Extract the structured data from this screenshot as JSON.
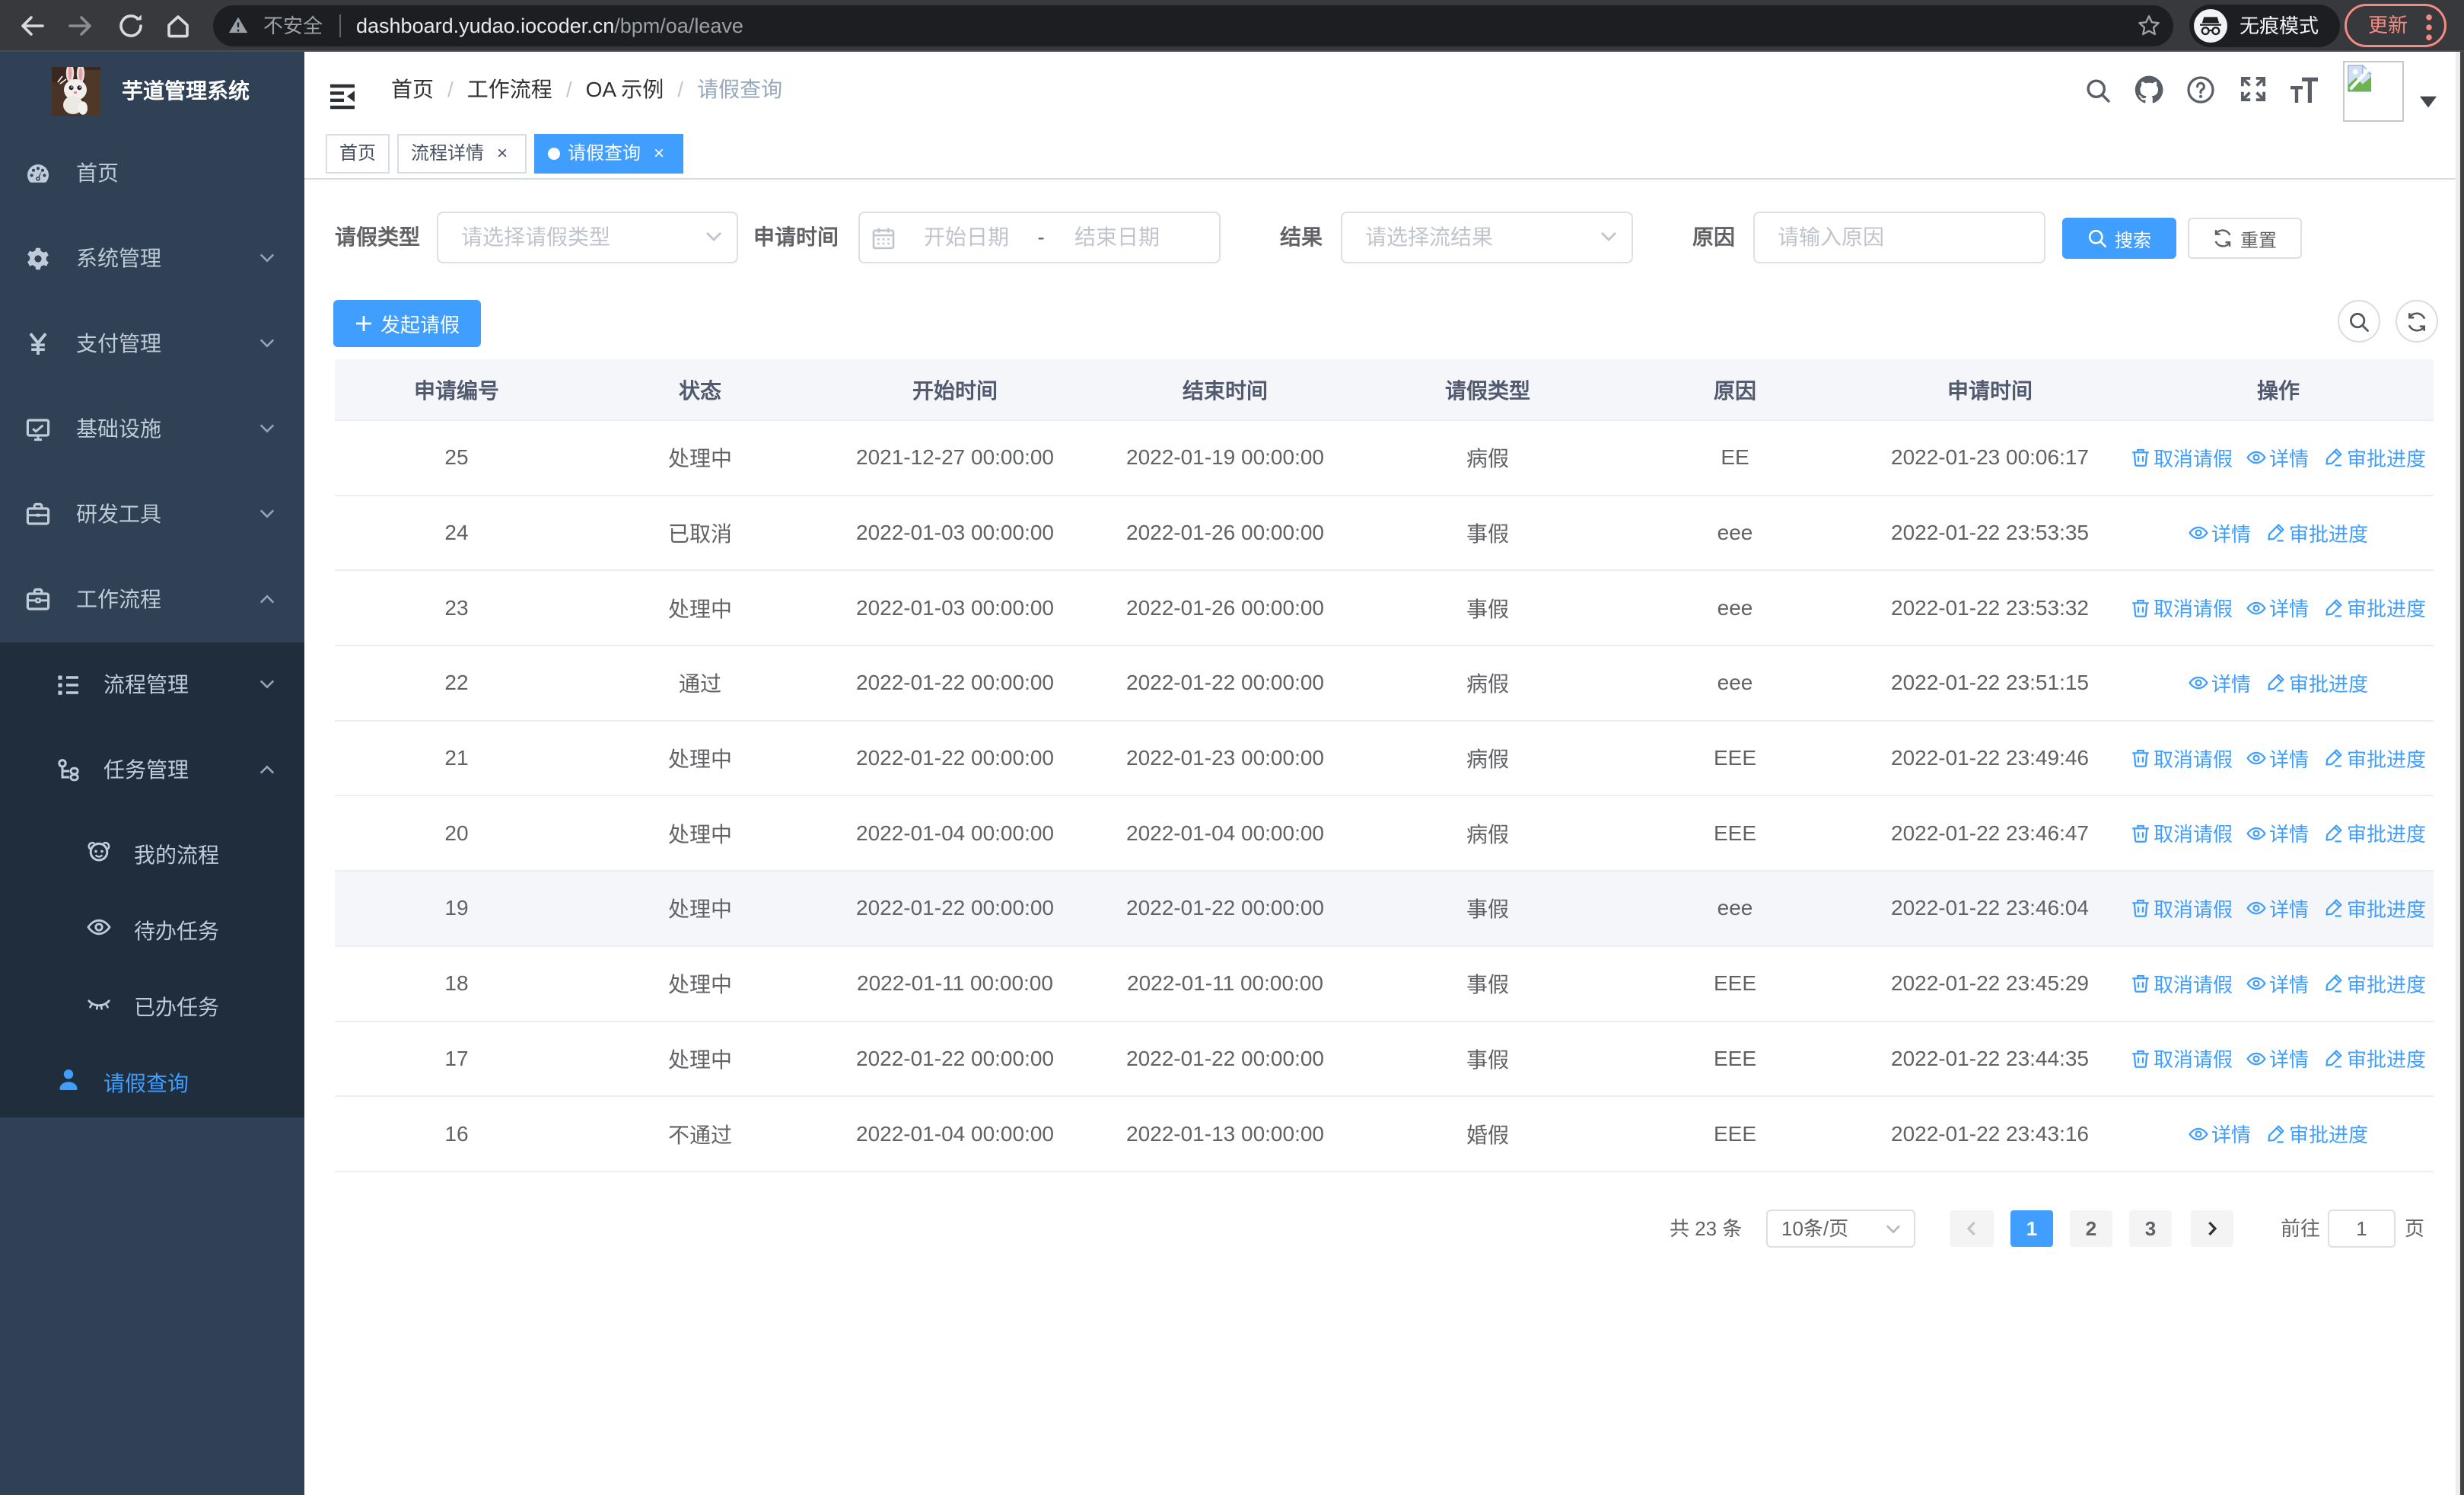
{
  "theme": {
    "accent": "#409eff",
    "sidebar_bg": "#304156",
    "submenu_bg": "#1f2d3d",
    "sidebar_text": "#bfcbd9",
    "chrome_bg": "#38393c",
    "omnibox_bg": "#1d1e21",
    "update_color": "#f28b82",
    "table_border": "#ebeef5"
  },
  "browser": {
    "security_label": "不安全",
    "url_host": "dashboard.yudao.iocoder.cn",
    "url_path": "/bpm/oa/leave",
    "incognito_label": "无痕模式",
    "update_label": "更新"
  },
  "sidebar": {
    "app_title": "芋道管理系统",
    "menu": [
      {
        "label": "首页",
        "icon": "dashboard",
        "level": 1
      },
      {
        "label": "系统管理",
        "icon": "gear",
        "level": 1,
        "arrow": "down"
      },
      {
        "label": "支付管理",
        "icon": "yen",
        "level": 1,
        "arrow": "down"
      },
      {
        "label": "基础设施",
        "icon": "infra",
        "level": 1,
        "arrow": "down"
      },
      {
        "label": "研发工具",
        "icon": "case",
        "level": 1,
        "arrow": "down"
      },
      {
        "label": "工作流程",
        "icon": "case2",
        "level": 1,
        "arrow": "up"
      },
      {
        "label": "流程管理",
        "icon": "listtree",
        "level": 2,
        "arrow": "down",
        "sub": true
      },
      {
        "label": "任务管理",
        "icon": "tasktree",
        "level": 2,
        "arrow": "up",
        "sub": true
      },
      {
        "label": "我的流程",
        "icon": "face",
        "level": 3,
        "sub": true,
        "h50": true
      },
      {
        "label": "待办任务",
        "icon": "eye",
        "level": 3,
        "sub": true,
        "h50": true
      },
      {
        "label": "已办任务",
        "icon": "eyeclosed",
        "level": 3,
        "sub": true,
        "h50": true
      },
      {
        "label": "请假查询",
        "icon": "user",
        "level": 2,
        "sub": true,
        "h50": true,
        "active": true
      }
    ]
  },
  "breadcrumb": {
    "items": [
      "首页",
      "工作流程",
      "OA 示例"
    ],
    "current": "请假查询"
  },
  "tags": [
    {
      "label": "首页",
      "closable": false,
      "active": false
    },
    {
      "label": "流程详情",
      "closable": true,
      "active": false
    },
    {
      "label": "请假查询",
      "closable": true,
      "active": true
    }
  ],
  "filters": {
    "leave_type_label": "请假类型",
    "leave_type_placeholder": "请选择请假类型",
    "apply_time_label": "申请时间",
    "start_placeholder": "开始日期",
    "range_separator": "-",
    "end_placeholder": "结束日期",
    "result_label": "结果",
    "result_placeholder": "请选择流结果",
    "reason_label": "原因",
    "reason_placeholder": "请输入原因",
    "search_label": "搜索",
    "reset_label": "重置"
  },
  "toolbar": {
    "create_label": "发起请假"
  },
  "table": {
    "columns": [
      "申请编号",
      "状态",
      "开始时间",
      "结束时间",
      "请假类型",
      "原因",
      "申请时间",
      "操作"
    ],
    "action_labels": {
      "cancel": "取消请假",
      "detail": "详情",
      "progress": "审批进度"
    },
    "rows": [
      {
        "id": "25",
        "status": "处理中",
        "start": "2021-12-27 00:00:00",
        "end": "2022-01-19 00:00:00",
        "type": "病假",
        "reason": "EE",
        "apply": "2022-01-23 00:06:17",
        "cancellable": true,
        "highlight": false
      },
      {
        "id": "24",
        "status": "已取消",
        "start": "2022-01-03 00:00:00",
        "end": "2022-01-26 00:00:00",
        "type": "事假",
        "reason": "eee",
        "apply": "2022-01-22 23:53:35",
        "cancellable": false,
        "highlight": false
      },
      {
        "id": "23",
        "status": "处理中",
        "start": "2022-01-03 00:00:00",
        "end": "2022-01-26 00:00:00",
        "type": "事假",
        "reason": "eee",
        "apply": "2022-01-22 23:53:32",
        "cancellable": true,
        "highlight": false
      },
      {
        "id": "22",
        "status": "通过",
        "start": "2022-01-22 00:00:00",
        "end": "2022-01-22 00:00:00",
        "type": "病假",
        "reason": "eee",
        "apply": "2022-01-22 23:51:15",
        "cancellable": false,
        "highlight": false
      },
      {
        "id": "21",
        "status": "处理中",
        "start": "2022-01-22 00:00:00",
        "end": "2022-01-23 00:00:00",
        "type": "病假",
        "reason": "EEE",
        "apply": "2022-01-22 23:49:46",
        "cancellable": true,
        "highlight": false
      },
      {
        "id": "20",
        "status": "处理中",
        "start": "2022-01-04 00:00:00",
        "end": "2022-01-04 00:00:00",
        "type": "病假",
        "reason": "EEE",
        "apply": "2022-01-22 23:46:47",
        "cancellable": true,
        "highlight": false
      },
      {
        "id": "19",
        "status": "处理中",
        "start": "2022-01-22 00:00:00",
        "end": "2022-01-22 00:00:00",
        "type": "事假",
        "reason": "eee",
        "apply": "2022-01-22 23:46:04",
        "cancellable": true,
        "highlight": true
      },
      {
        "id": "18",
        "status": "处理中",
        "start": "2022-01-11 00:00:00",
        "end": "2022-01-11 00:00:00",
        "type": "事假",
        "reason": "EEE",
        "apply": "2022-01-22 23:45:29",
        "cancellable": true,
        "highlight": false
      },
      {
        "id": "17",
        "status": "处理中",
        "start": "2022-01-22 00:00:00",
        "end": "2022-01-22 00:00:00",
        "type": "事假",
        "reason": "EEE",
        "apply": "2022-01-22 23:44:35",
        "cancellable": true,
        "highlight": false
      },
      {
        "id": "16",
        "status": "不通过",
        "start": "2022-01-04 00:00:00",
        "end": "2022-01-13 00:00:00",
        "type": "婚假",
        "reason": "EEE",
        "apply": "2022-01-22 23:43:16",
        "cancellable": false,
        "highlight": false
      }
    ]
  },
  "pagination": {
    "total_text": "共 23 条",
    "page_size": "10条/页",
    "pages": [
      "1",
      "2",
      "3"
    ],
    "active_page": "1",
    "goto_label": "前往",
    "goto_value": "1",
    "page_unit": "页"
  }
}
